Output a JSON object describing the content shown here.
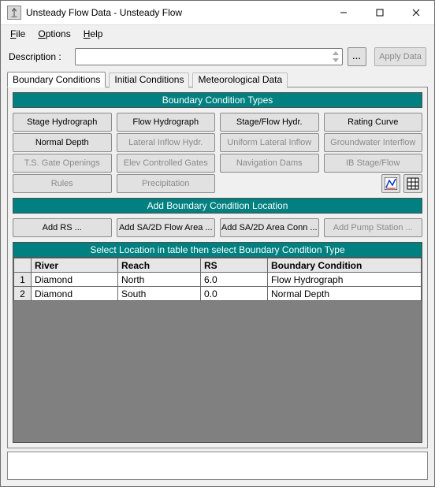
{
  "title": "Unsteady Flow Data - Unsteady Flow",
  "menu": {
    "file": "File",
    "options": "Options",
    "help": "Help"
  },
  "description": {
    "label": "Description :",
    "value": "",
    "browse": "...",
    "apply": "Apply Data"
  },
  "tabs": {
    "boundary": "Boundary Conditions",
    "initial": "Initial Conditions",
    "meteo": "Meteorological Data"
  },
  "bct": {
    "header": "Boundary Condition Types",
    "buttons": [
      {
        "label": "Stage Hydrograph",
        "enabled": true
      },
      {
        "label": "Flow Hydrograph",
        "enabled": true
      },
      {
        "label": "Stage/Flow Hydr.",
        "enabled": true
      },
      {
        "label": "Rating Curve",
        "enabled": true
      },
      {
        "label": "Normal Depth",
        "enabled": true
      },
      {
        "label": "Lateral Inflow Hydr.",
        "enabled": false
      },
      {
        "label": "Uniform Lateral Inflow",
        "enabled": false
      },
      {
        "label": "Groundwater Interflow",
        "enabled": false
      },
      {
        "label": "T.S. Gate Openings",
        "enabled": false
      },
      {
        "label": "Elev Controlled Gates",
        "enabled": false
      },
      {
        "label": "Navigation Dams",
        "enabled": false
      },
      {
        "label": "IB Stage/Flow",
        "enabled": false
      },
      {
        "label": "Rules",
        "enabled": false
      },
      {
        "label": "Precipitation",
        "enabled": false
      }
    ]
  },
  "loc": {
    "header": "Add Boundary Condition Location",
    "buttons": [
      {
        "label": "Add RS ...",
        "enabled": true
      },
      {
        "label": "Add SA/2D Flow Area ...",
        "enabled": true
      },
      {
        "label": "Add SA/2D Area Conn ...",
        "enabled": true
      },
      {
        "label": "Add Pump Station ...",
        "enabled": false
      }
    ]
  },
  "table": {
    "header": "Select Location in table then select Boundary Condition Type",
    "columns": [
      "River",
      "Reach",
      "RS",
      "Boundary Condition"
    ],
    "rows": [
      {
        "n": "1",
        "river": "Diamond",
        "reach": "North",
        "rs": "6.0",
        "bc": "Flow Hydrograph"
      },
      {
        "n": "2",
        "river": "Diamond",
        "reach": "South",
        "rs": "0.0",
        "bc": "Normal Depth"
      }
    ]
  }
}
